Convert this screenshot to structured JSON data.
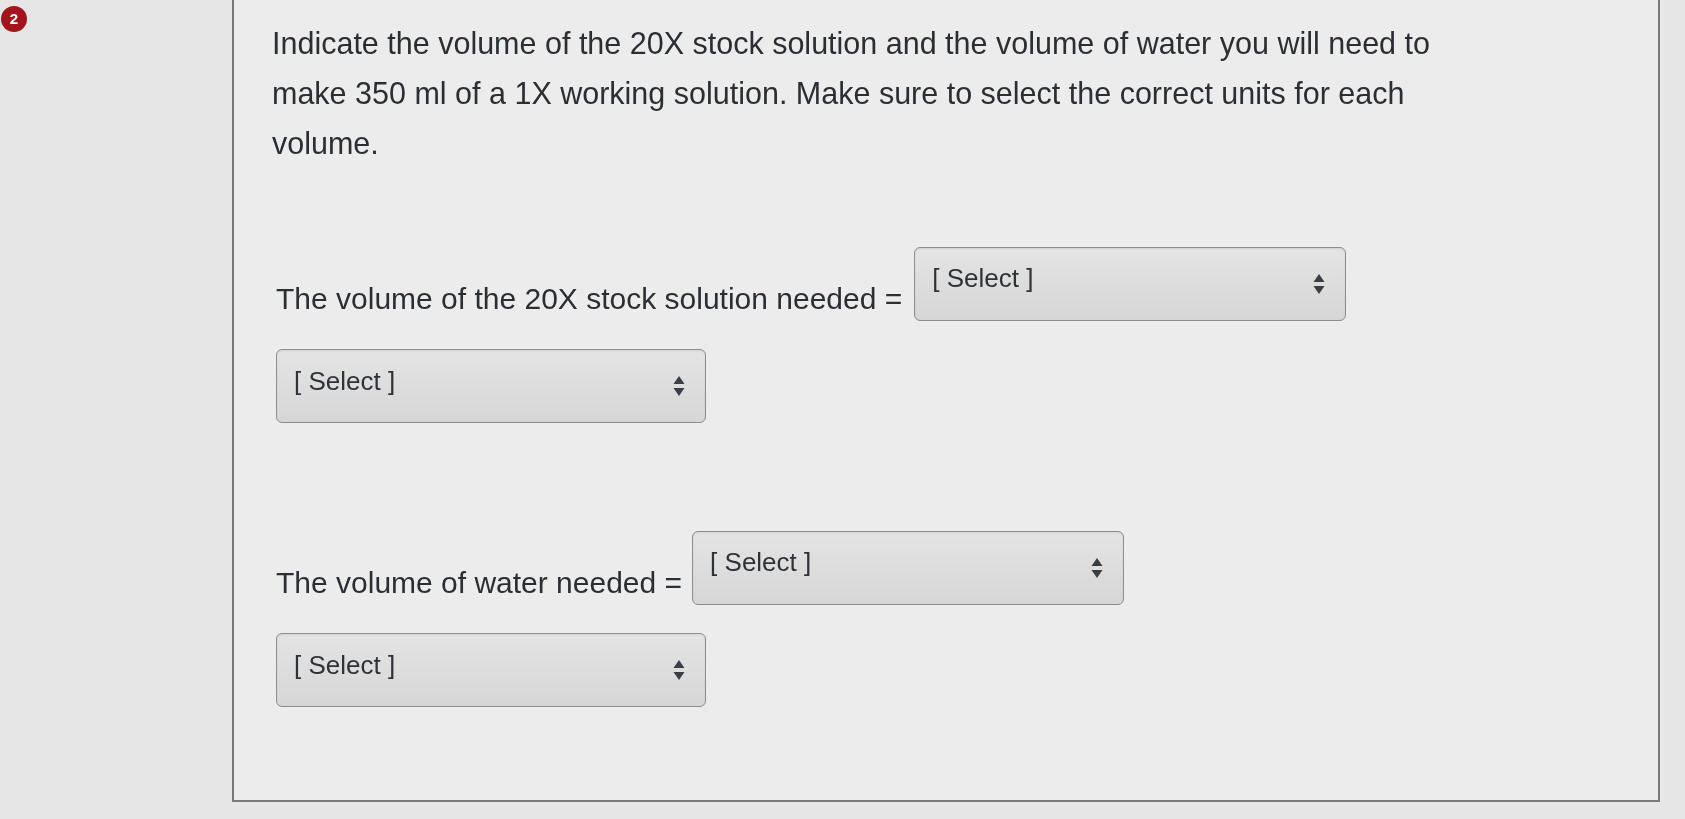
{
  "question_number": "2",
  "prompt": "Indicate the volume of the 20X stock solution and the volume of water you will need to make 350 ml of a 1X working solution. Make sure to select the correct units for each volume.",
  "blanks": [
    {
      "label": "The volume of the 20X stock solution needed =",
      "amount_select": {
        "value": "[ Select ]"
      },
      "unit_select": {
        "value": "[ Select ]"
      }
    },
    {
      "label": "The volume of water needed =",
      "amount_select": {
        "value": "[ Select ]"
      },
      "unit_select": {
        "value": "[ Select ]"
      }
    }
  ]
}
